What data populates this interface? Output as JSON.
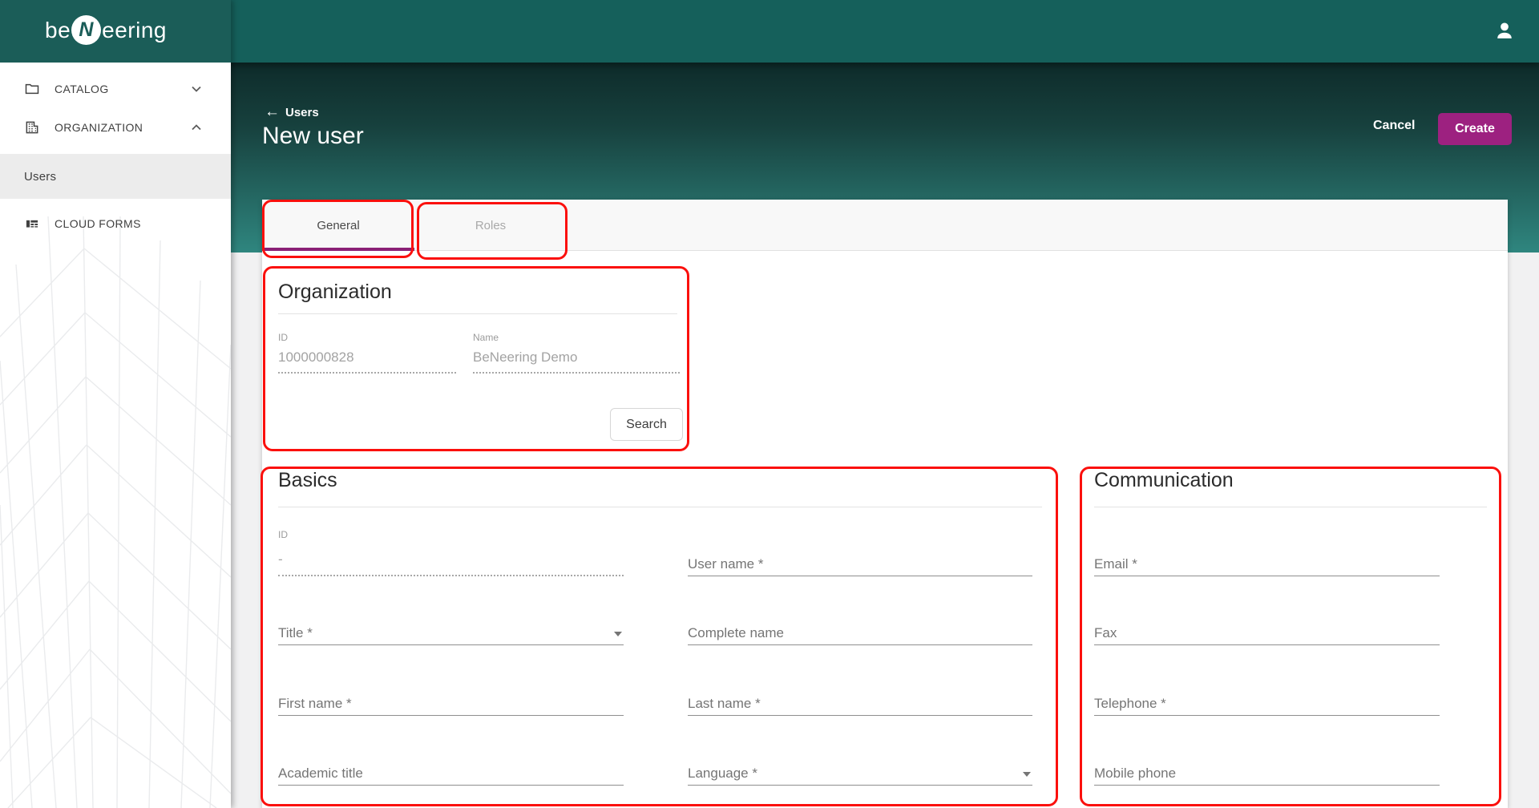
{
  "brand": {
    "be": "be",
    "n": "N",
    "eering": "eering"
  },
  "sidebar": {
    "items": [
      {
        "label": "CATALOG",
        "icon": "folder-icon",
        "chevron": "chevron-down"
      },
      {
        "label": "ORGANIZATION",
        "icon": "organization-building-icon",
        "chevron": "chevron-up"
      },
      {
        "label": "Users",
        "active": true
      },
      {
        "label": "CLOUD FORMS",
        "icon": "cloud-forms-icon"
      }
    ]
  },
  "header": {
    "back_arrow": "←",
    "breadcrumb": "Users",
    "title": "New user",
    "cancel_label": "Cancel",
    "create_label": "Create"
  },
  "tabs": [
    {
      "label": "General",
      "active": true
    },
    {
      "label": "Roles",
      "active": false
    }
  ],
  "organization": {
    "title": "Organization",
    "id": {
      "label": "ID",
      "value": "1000000828"
    },
    "name": {
      "label": "Name",
      "value": "BeNeering Demo"
    },
    "search_label": "Search"
  },
  "basics": {
    "title": "Basics",
    "id": {
      "label": "ID",
      "value": "-"
    },
    "user_name": "User name *",
    "title_field": "Title *",
    "complete_name": "Complete name",
    "first_name": "First name *",
    "last_name": "Last name *",
    "academic_title": "Academic title",
    "language": "Language *"
  },
  "communication": {
    "title": "Communication",
    "email": "Email *",
    "fax": "Fax",
    "telephone": "Telephone *",
    "mobile_phone": "Mobile phone"
  },
  "colors": {
    "topbar_teal": "#15605b",
    "create_magenta": "#9d2180",
    "active_tab_underline": "#8b2076",
    "annotation_red": "#fb100d"
  }
}
